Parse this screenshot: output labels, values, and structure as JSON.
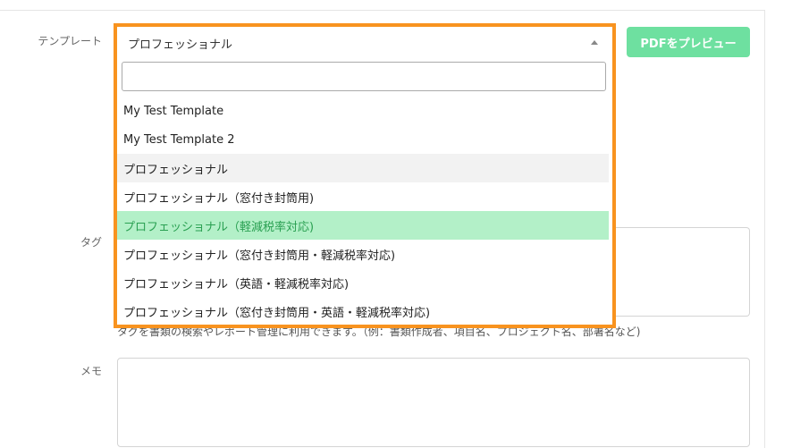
{
  "form": {
    "template_label": "テンプレート",
    "tag_label": "タグ",
    "memo_label": "メモ",
    "preview_button": "PDFをプレビュー",
    "tag_helper": "タグを書類の検索やレポート管理に利用できます。（例：書類作成者、項目名、プロジェクト名、部署名など)"
  },
  "template_select": {
    "selected": "プロフェッショナル",
    "search_value": "",
    "options": [
      {
        "label": "My Test Template"
      },
      {
        "label": "My Test Template 2"
      },
      {
        "label": "プロフェッショナル"
      },
      {
        "label": "プロフェッショナル（窓付き封筒用)"
      },
      {
        "label": "プロフェッショナル（軽減税率対応)"
      },
      {
        "label": "プロフェッショナル（窓付き封筒用・軽減税率対応)"
      },
      {
        "label": "プロフェッショナル（英語・軽減税率対応)"
      },
      {
        "label": "プロフェッショナル（窓付き封筒用・英語・軽減税率対応)"
      }
    ]
  },
  "colors": {
    "highlight_border": "#f8931f",
    "selected_bg": "#b3f0c8",
    "selected_text": "#2aa052",
    "button_bg": "#6ee0a0"
  }
}
